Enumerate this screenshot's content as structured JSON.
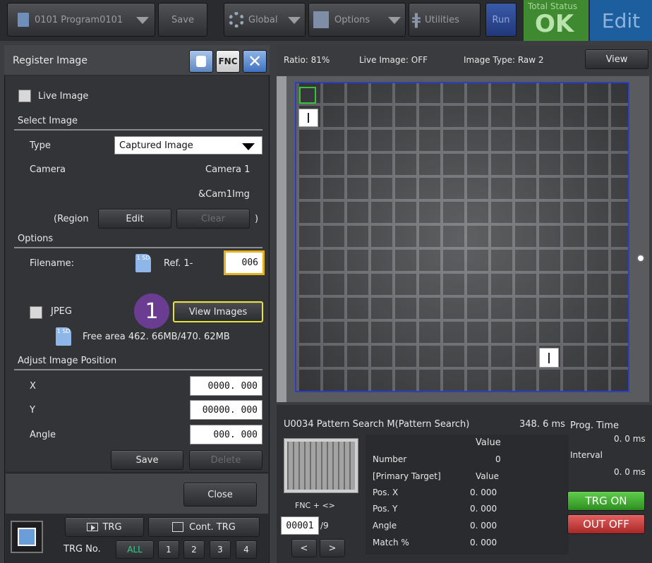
{
  "topbar": {
    "program": "0101  Program0101",
    "save": "Save",
    "global": "Global",
    "options": "Options",
    "utilities": "Utilities",
    "run": "Run",
    "status_label": "Total Status",
    "status_value": "OK",
    "edit": "Edit",
    "colors": {
      "ok": "#3c8c2c",
      "edit": "#1b5f9e",
      "run": "#2a4a9a"
    }
  },
  "panel": {
    "title": "Register  Image",
    "fnc": "FNC",
    "live_image": "Live  Image",
    "select_image": "Select  Image",
    "type_label": "Type",
    "type_value": "Captured  Image",
    "camera_label": "Camera",
    "camera_value": "Camera  1",
    "cam_var": "&Cam1Img",
    "region_open": "(Region",
    "region_edit": "Edit",
    "region_clear": "Clear",
    "region_close": ")",
    "options": "Options",
    "filename_label": "Filename:",
    "sd_icon": "1 SD",
    "ref_label": "Ref.  1-",
    "ref_value": "006",
    "jpeg_label": "JPEG",
    "view_images": "View  Images",
    "callout": "1",
    "free_area": "Free  area  462. 66MB/470. 62MB",
    "adjust_title": "Adjust  Image  Position",
    "x_label": "X",
    "x_value": "0000. 000",
    "y_label": "Y",
    "y_value": "00000. 000",
    "angle_label": "Angle",
    "angle_value": "000. 000",
    "save": "Save",
    "delete": "Delete",
    "close": "Close",
    "trg": "TRG",
    "cont_trg": "Cont. TRG",
    "trg_no_label": "TRG  No.",
    "trg_nos": [
      "ALL",
      "1",
      "2",
      "3",
      "4"
    ]
  },
  "view": {
    "ratio": "Ratio:  81%",
    "live": "Live  Image:  OFF",
    "image_type": "Image  Type:  Raw  2",
    "view_btn": "View"
  },
  "result": {
    "unit": "U0034  Pattern  Search  M(Pattern  Search)",
    "time": "348. 6 ms",
    "prog_time_label": "Prog.   Time",
    "prog_time_value": "0. 0 ms",
    "interval_label": "Interval",
    "interval_value": "0. 0 ms",
    "fnc_nav": "FNC  +  <>",
    "counter": "00001",
    "counter_total": "/9",
    "prev": "<",
    "next": ">",
    "value_header": "Value",
    "rows": [
      {
        "label": "Number",
        "value": "0"
      },
      {
        "label": "[Primary  Target]",
        "value": "Value"
      },
      {
        "label": "Pos.   X",
        "value": "0. 000"
      },
      {
        "label": "Pos.   Y",
        "value": "0. 000"
      },
      {
        "label": "Angle",
        "value": "0. 000"
      },
      {
        "label": "Match  %",
        "value": "0. 000"
      }
    ],
    "trg_on": "TRG ON",
    "out_off": "OUT OFF"
  }
}
